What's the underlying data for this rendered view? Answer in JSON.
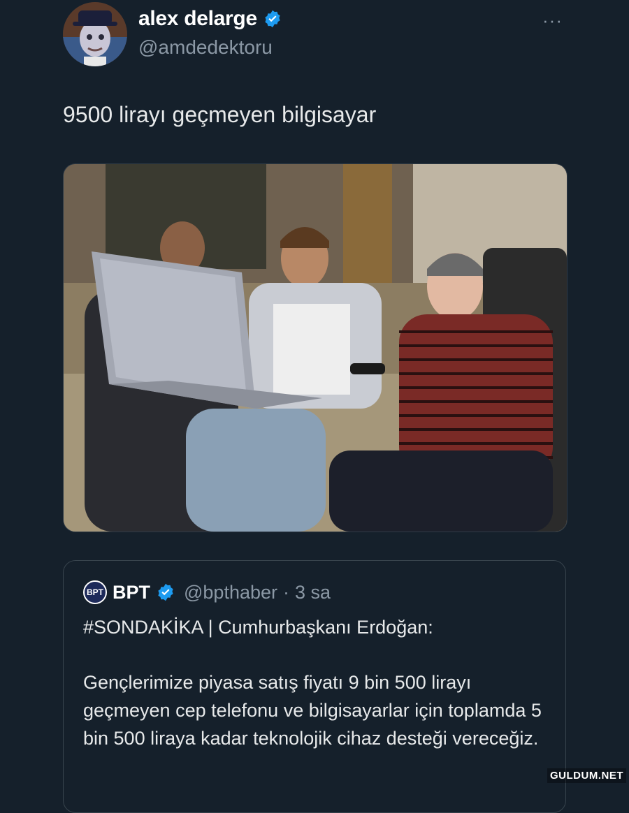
{
  "tweet": {
    "author_name": "alex delarge",
    "author_handle": "@amdedektoru",
    "more_label": "···",
    "text": "9500 lirayı geçmeyen bilgisayar"
  },
  "quote": {
    "logo_text": "BPT",
    "name": "BPT",
    "handle": "@bpthaber",
    "dot": "·",
    "time": "3 sa",
    "headline": "#SONDAKİKA | Cumhurbaşkanı Erdoğan:",
    "body": "Gençlerimize piyasa satış fiyatı 9 bin 500 lirayı geçmeyen cep telefonu ve bilgisayarlar için toplamda 5 bin 500 liraya kadar teknolojik cihaz desteği vereceğiz."
  },
  "watermark": "GULDUM.NET",
  "colors": {
    "background": "#15202b",
    "verified": "#1d9bf0",
    "secondary_text": "#8b98a5"
  }
}
